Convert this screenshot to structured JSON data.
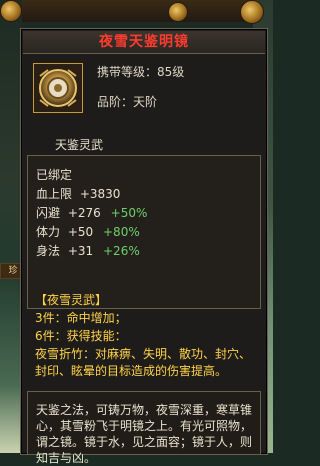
{
  "tooltip": {
    "item_name": "夜雪天鉴明镜",
    "carry_level": "携带等级：85级",
    "grade": "品阶：天阶",
    "subtitle": "天鉴灵武",
    "status": "已绑定",
    "stats": [
      {
        "label": "血上限",
        "value": "+3830",
        "pct": ""
      },
      {
        "label": "闪避",
        "value": "+276",
        "pct": "+50%"
      },
      {
        "label": "体力",
        "value": "+50",
        "pct": "+80%"
      },
      {
        "label": "身法",
        "value": "+31",
        "pct": "+26%"
      }
    ],
    "set_name": "【夜雪灵武】",
    "set_bonus_3": "3件：命中增加；",
    "set_bonus_6": "6件：获得技能：",
    "effect_text": "夜雪折竹：对麻痹、失明、散功、封穴、封印、眩晕的目标造成的伤害提高。",
    "description": "天鉴之法，可铸万物，夜雪深重，寒草锥心，其雪粉飞于明镜之上。有光可照物，谓之镜。镜于水，见之面容；镜于人，则知吉与凶。"
  },
  "background": {
    "left_strip_text": "珍"
  },
  "colors": {
    "title": "#ff3b30",
    "highlight_green": "#6fd06a",
    "set_yellow": "#ffd34a",
    "border": "#6a5f4c"
  }
}
